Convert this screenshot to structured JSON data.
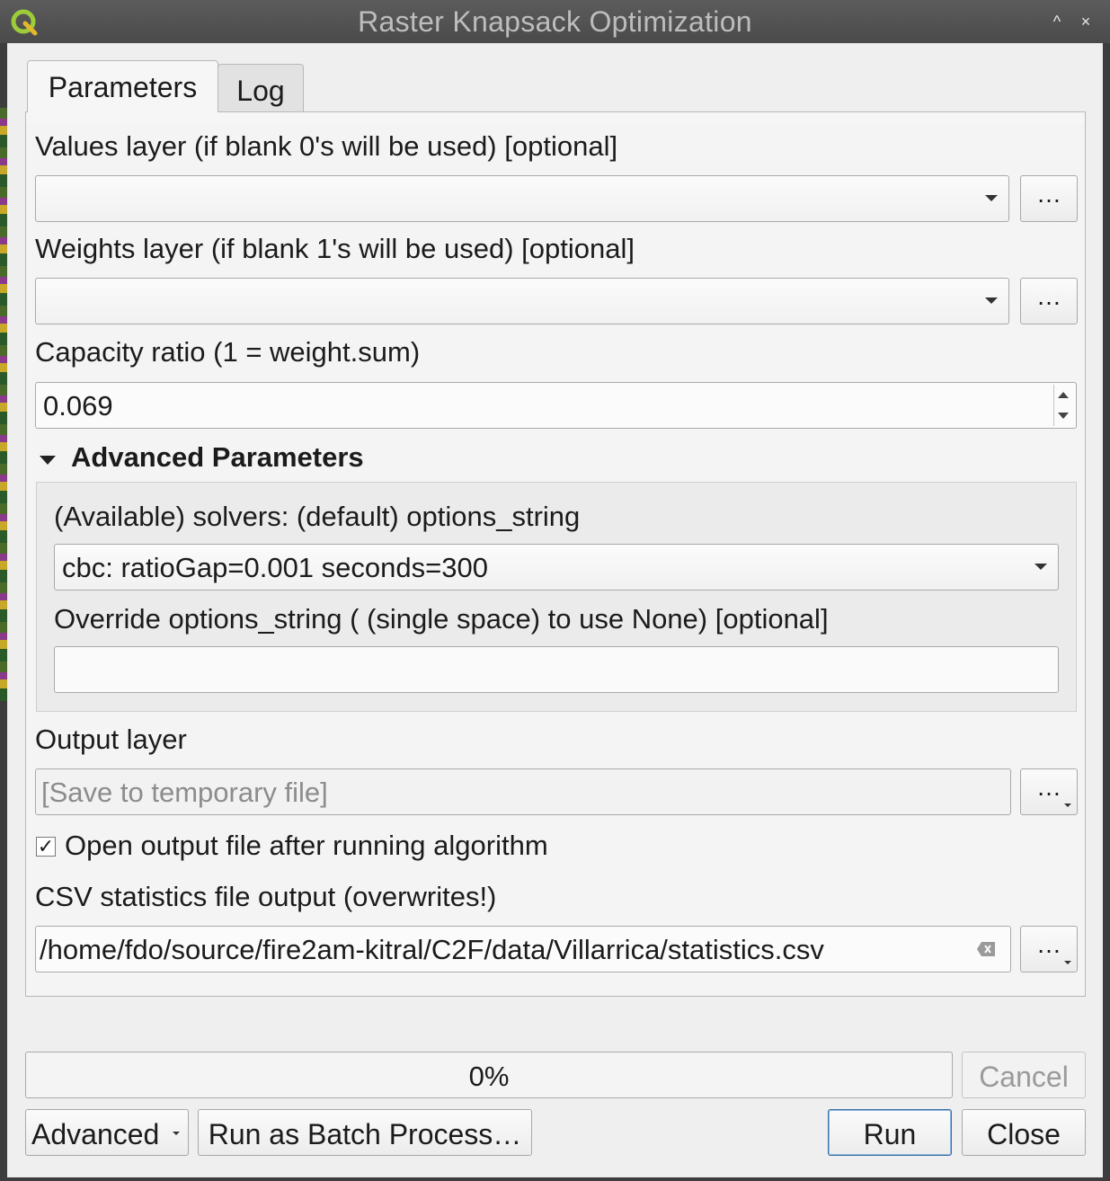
{
  "window": {
    "title": "Raster Knapsack Optimization",
    "minimize_glyph": "^",
    "close_glyph": "×"
  },
  "tabs": [
    {
      "label": "Parameters",
      "active": true
    },
    {
      "label": "Log",
      "active": false
    }
  ],
  "params": {
    "values_layer": {
      "label": "Values layer (if blank 0's will be used) [optional]",
      "value": "",
      "browse": "…"
    },
    "weights_layer": {
      "label": "Weights layer (if blank 1's will be used) [optional]",
      "value": "",
      "browse": "…"
    },
    "capacity": {
      "label": "Capacity ratio (1 = weight.sum)",
      "value": "0.069"
    },
    "advanced": {
      "title": "Advanced Parameters",
      "expanded": true,
      "solvers_label": "(Available) solvers: (default) options_string",
      "solvers_value": "cbc: ratioGap=0.001 seconds=300",
      "override_label": "Override options_string ( (single space) to use None) [optional]",
      "override_value": ""
    },
    "output_layer": {
      "label": "Output layer",
      "placeholder": "[Save to temporary file]",
      "browse": "…"
    },
    "open_output": {
      "label": "Open output file after running algorithm",
      "checked": true,
      "check_glyph": "✓"
    },
    "csv_output": {
      "label": "CSV statistics file output (overwrites!)",
      "value": "/home/fdo/source/fire2am-kitral/C2F/data/Villarrica/statistics.csv",
      "browse": "…"
    }
  },
  "progress": {
    "value": 0,
    "text": "0%"
  },
  "buttons": {
    "cancel": "Cancel",
    "advanced": "Advanced",
    "batch": "Run as Batch Process…",
    "run": "Run",
    "close": "Close"
  },
  "colors": {
    "progress_fill": "#6aa0d8",
    "default_button_border": "#3a6fa8"
  }
}
